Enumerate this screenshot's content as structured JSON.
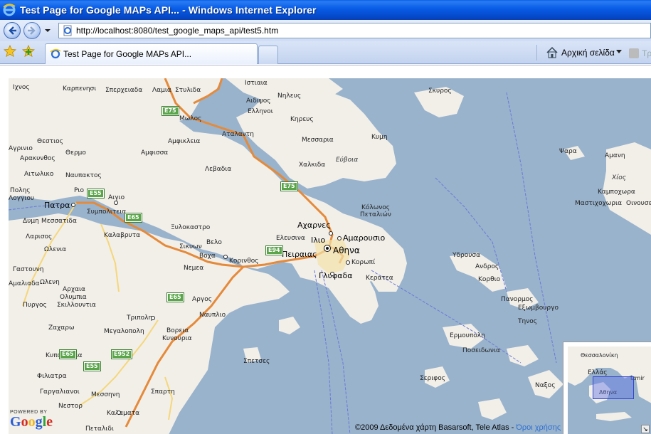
{
  "window": {
    "title": "Test Page for Google MAPs API... - Windows Internet Explorer"
  },
  "address_bar": {
    "url": "http://localhost:8080/test_google_maps_api/test5.htm"
  },
  "tabs": [
    {
      "label": "Test Page for Google MAPs API..."
    }
  ],
  "toolbar": {
    "home_label": "Αρχική σελίδα",
    "feeds_label": "Τρ"
  },
  "map": {
    "labels": {
      "ixos": "Ιχνος",
      "karpenisi": "Καρπενησι",
      "sperxeiada": "Σπερχειαδα",
      "lamia": "Λαμια",
      "stylida": "Στυλιδα",
      "istiaia": "Ιστιαια",
      "skiros": "Σκυρος",
      "nileus": "Νηλευς",
      "aidipsos": "Αιδιψος",
      "ellinoi": "Ελληνοι",
      "molos": "Μωλος",
      "atalanti": "Αταλαντη",
      "amfikleia": "Αμφικλεια",
      "krypous": "Κηρευς",
      "mesaria": "Μεσσαρια",
      "kymi": "Κυμη",
      "evia": "Εύβοια",
      "chalkida": "Χαλκιδα",
      "thermo": "Θερμο",
      "agrinio": "Αγρινιο",
      "thestios": "Θεστιος",
      "arakynthos": "Αρακυνθος",
      "amfissa": "Αμφισσα",
      "levadia": "Λεβαδια",
      "aitoliko": "Αιτωλικο",
      "nafpaktos": "Ναυπακτος",
      "rio": "Ριο",
      "polis": "Πολης",
      "loggiou": "Λογγιου",
      "patra": "Πατρα",
      "aigio": "Αιγιο",
      "symploiteia": "Συμπολιτεια",
      "dymi": "Δυμη",
      "messatida": "Μεσσατιδα",
      "kolwnos": "Κόλωνος",
      "petalioi": "Πεταλιών",
      "xylokastro": "Ξυλοκαστρο",
      "acharnes": "Αχαρνες",
      "amarousio": "Αμαρουσιο",
      "elefsina": "Ελευσινα",
      "ilio": "Ιλιο",
      "athina": "Αθηνα",
      "peiraias": "Πειραιας",
      "korwpi": "Κορωπί",
      "glyfada": "Γλυφαδα",
      "keratea": "Κερατεα",
      "larisos": "Λαρισος",
      "kalavryta": "Καλαβρυτα",
      "olenia": "Ωλενια",
      "sikyon": "Σικυων",
      "velo": "Βελο",
      "voxa": "Βοχα",
      "korinthos": "Κορινθος",
      "nemea": "Νεμεα",
      "gastouni": "Γαστουνη",
      "amaliada": "Αμαλιαδα",
      "oleni": "Ωλενη",
      "archaia": "Αρχαια",
      "olympia": "Ολυμπια",
      "pyrgos": "Πυργος",
      "skillountia": "Σκιλλουντια",
      "argos": "Αργος",
      "nafplio": "Ναυπλιο",
      "tripoli": "Τριπολη",
      "zacharo": "Ζαχαρω",
      "megalopoli": "Μεγαλοπολη",
      "voreia": "Βορεια",
      "kynouria": "Κυνουρια",
      "kyparissia": "Κυπαρισσια",
      "spetses": "Σπετσες",
      "fillatra": "Φιλιατρα",
      "gargalianoi": "Γαργαλιανοι",
      "messini": "Μεσσηνη",
      "nestor": "Νεστορ",
      "kalamata": "Καλαματα",
      "petalidi": "Πεταλιδι",
      "sparti": "Σπαρτη",
      "ydroussa": "Υδρουσα",
      "androu": "Ανδρος",
      "korthio": "Κορθιο",
      "panormos": "Πανορμος",
      "exomvourgo": "Εξωμβουργο",
      "tinos": "Τηνος",
      "ermoupoli": "Ερμουπολη",
      "poseidonia": "Ποσειδωνια",
      "serifos": "Σεριφος",
      "naxos": "Ναξος",
      "psara": "Ψαρα",
      "amani": "Αμανη",
      "chios": "Χίος",
      "kampochora": "Καμποχωρα",
      "mastichochoria": "Μαστιχοχωρια",
      "oinouses": "Οινουσες"
    },
    "shields": {
      "e75a": "E75",
      "e75b": "E75",
      "e55a": "E55",
      "e65a": "E65",
      "e94": "E94",
      "e65b": "E65",
      "e65c": "E65",
      "e952": "E952",
      "e55b": "E55"
    },
    "logo_powered": "POWERED BY",
    "logo_text": "Google",
    "copyright": "©2009 Δεδομένα χάρτη Basarsoft, Tele Atlas - ",
    "terms_link": "Όροι χρήσης",
    "overview": {
      "thessaloniki": "Θεσσαλονίκη",
      "ellada": "Ελλάς",
      "izmir": "Izmir",
      "athina": "Αθηνα"
    }
  },
  "colors": {
    "sea": "#99b3cc",
    "land": "#f2efe9",
    "highway": "#e58a3a",
    "ie_blue": "#0a5ee8"
  }
}
